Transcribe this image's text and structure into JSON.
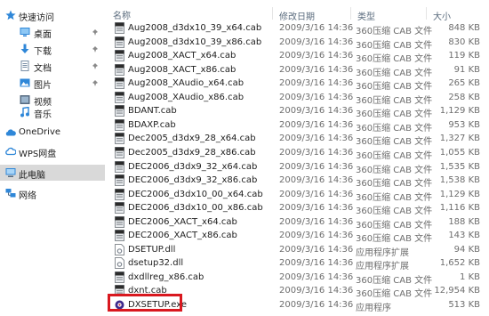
{
  "nav": {
    "quick_access": "快速访问",
    "desktop": "桌面",
    "downloads": "下载",
    "documents": "文档",
    "pictures": "图片",
    "videos": "视频",
    "music": "音乐",
    "onedrive": "OneDrive",
    "wps": "WPS网盘",
    "this_pc": "此电脑",
    "network": "网络"
  },
  "header": {
    "name": "名称",
    "date": "修改日期",
    "type": "类型",
    "size": "大小"
  },
  "files": [
    {
      "name": "Aug2008_d3dx10_39_x64.cab",
      "date": "2009/3/16 14:36",
      "type": "360压缩 CAB 文件",
      "size": "848 KB"
    },
    {
      "name": "Aug2008_d3dx10_39_x86.cab",
      "date": "2009/3/16 14:36",
      "type": "360压缩 CAB 文件",
      "size": "830 KB"
    },
    {
      "name": "Aug2008_XACT_x64.cab",
      "date": "2009/3/16 14:36",
      "type": "360压缩 CAB 文件",
      "size": "119 KB"
    },
    {
      "name": "Aug2008_XACT_x86.cab",
      "date": "2009/3/16 14:36",
      "type": "360压缩 CAB 文件",
      "size": "91 KB"
    },
    {
      "name": "Aug2008_XAudio_x64.cab",
      "date": "2009/3/16 14:36",
      "type": "360压缩 CAB 文件",
      "size": "265 KB"
    },
    {
      "name": "Aug2008_XAudio_x86.cab",
      "date": "2009/3/16 14:36",
      "type": "360压缩 CAB 文件",
      "size": "258 KB"
    },
    {
      "name": "BDANT.cab",
      "date": "2009/3/16 14:36",
      "type": "360压缩 CAB 文件",
      "size": "1,129 KB"
    },
    {
      "name": "BDAXP.cab",
      "date": "2009/3/16 14:36",
      "type": "360压缩 CAB 文件",
      "size": "953 KB"
    },
    {
      "name": "Dec2005_d3dx9_28_x64.cab",
      "date": "2009/3/16 14:36",
      "type": "360压缩 CAB 文件",
      "size": "1,327 KB"
    },
    {
      "name": "Dec2005_d3dx9_28_x86.cab",
      "date": "2009/3/16 14:36",
      "type": "360压缩 CAB 文件",
      "size": "1,055 KB"
    },
    {
      "name": "DEC2006_d3dx9_32_x64.cab",
      "date": "2009/3/16 14:36",
      "type": "360压缩 CAB 文件",
      "size": "1,535 KB"
    },
    {
      "name": "DEC2006_d3dx9_32_x86.cab",
      "date": "2009/3/16 14:36",
      "type": "360压缩 CAB 文件",
      "size": "1,538 KB"
    },
    {
      "name": "DEC2006_d3dx10_00_x64.cab",
      "date": "2009/3/16 14:36",
      "type": "360压缩 CAB 文件",
      "size": "1,129 KB"
    },
    {
      "name": "DEC2006_d3dx10_00_x86.cab",
      "date": "2009/3/16 14:36",
      "type": "360压缩 CAB 文件",
      "size": "1,116 KB"
    },
    {
      "name": "DEC2006_XACT_x64.cab",
      "date": "2009/3/16 14:36",
      "type": "360压缩 CAB 文件",
      "size": "188 KB"
    },
    {
      "name": "DEC2006_XACT_x86.cab",
      "date": "2009/3/16 14:36",
      "type": "360压缩 CAB 文件",
      "size": "143 KB"
    },
    {
      "name": "DSETUP.dll",
      "date": "2009/3/16 14:36",
      "type": "应用程序扩展",
      "size": "94 KB"
    },
    {
      "name": "dsetup32.dll",
      "date": "2009/3/16 14:36",
      "type": "应用程序扩展",
      "size": "1,652 KB"
    },
    {
      "name": "dxdllreg_x86.cab",
      "date": "2009/3/16 14:36",
      "type": "360压缩 CAB 文件",
      "size": "1 KB"
    },
    {
      "name": "dxnt.cab",
      "date": "2009/3/16 14:36",
      "type": "360压缩 CAB 文件",
      "size": "12,954 KB"
    },
    {
      "name": "DXSETUP.exe",
      "date": "2009/3/16 14:36",
      "type": "应用程序",
      "size": "513 KB"
    }
  ]
}
